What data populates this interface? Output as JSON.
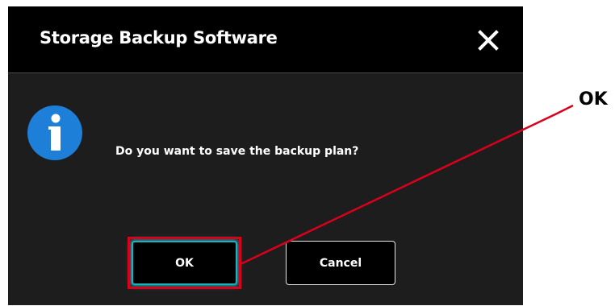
{
  "dialog": {
    "title": "Storage Backup Software",
    "close_icon": "close-icon",
    "info_icon": "info-icon",
    "message": "Do you want to save the backup plan?",
    "ok_label": "OK",
    "cancel_label": "Cancel"
  },
  "annotation": {
    "callout_label": "OK",
    "highlight_color": "#d9001b"
  },
  "colors": {
    "dialog_background": "#1d1d1d",
    "titlebar_background": "#000000",
    "info_icon_blue": "#1e7fd8",
    "ok_focus_glow": "#1bb3bd"
  }
}
